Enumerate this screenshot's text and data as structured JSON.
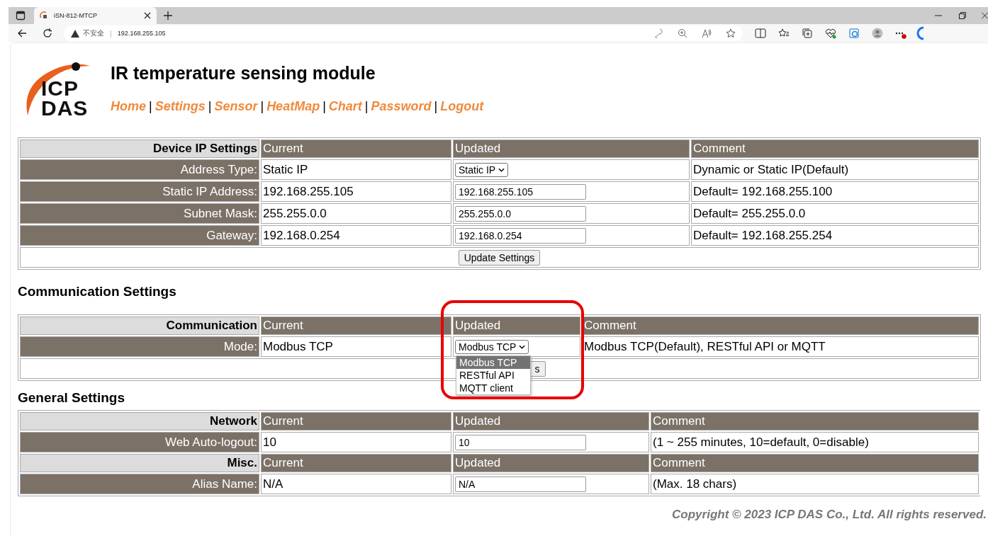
{
  "browser": {
    "tab_title": "iSN-812-MTCP",
    "security_label": "不安全",
    "divider": "|",
    "url": "192.168.255.105"
  },
  "header": {
    "logo_lines": [
      "ICP",
      "DAS"
    ],
    "title": "IR temperature sensing module",
    "separator": "|",
    "nav": [
      {
        "label": "Home"
      },
      {
        "label": "Settings"
      },
      {
        "label": "Sensor"
      },
      {
        "label": "HeatMap"
      },
      {
        "label": "Chart"
      },
      {
        "label": "Password"
      },
      {
        "label": "Logout"
      }
    ]
  },
  "sections": [
    {
      "head": [
        "Device IP Settings",
        "Current",
        "Updated",
        "Comment"
      ],
      "rows": [
        {
          "label": "Address Type:",
          "current": "Static IP",
          "updated": {
            "kind": "select",
            "value": "Static IP"
          },
          "comment": "Dynamic or Static IP(Default)"
        },
        {
          "label": "Static IP Address:",
          "current": "192.168.255.105",
          "updated": {
            "kind": "input",
            "value": "192.168.255.105"
          },
          "comment": "Default= 192.168.255.100"
        },
        {
          "label": "Subnet Mask:",
          "current": "255.255.0.0",
          "updated": {
            "kind": "input",
            "value": "255.255.0.0"
          },
          "comment": "Default= 255.255.0.0"
        },
        {
          "label": "Gateway:",
          "current": "192.168.0.254",
          "updated": {
            "kind": "input",
            "value": "192.168.0.254"
          },
          "comment": "Default= 192.168.255.254"
        }
      ],
      "button": {
        "label": "Update Settings",
        "covered": false
      }
    },
    {
      "title": "Communication Settings",
      "head": [
        "Communication",
        "Current",
        "Updated",
        "Comment"
      ],
      "rows": [
        {
          "label": "Mode:",
          "current": "Modbus TCP",
          "updated": {
            "kind": "select",
            "value": "Modbus TCP",
            "open": true,
            "options": [
              {
                "label": "Modbus TCP",
                "selected": true
              },
              {
                "label": "RESTful API",
                "selected": false
              },
              {
                "label": "MQTT client",
                "selected": false
              }
            ]
          },
          "comment": "Modbus TCP(Default), RESTful API or MQTT"
        }
      ],
      "button": {
        "label": "s",
        "covered": true
      }
    },
    {
      "title": "General Settings",
      "groups": [
        {
          "head": [
            "Network",
            "Current",
            "Updated",
            "Comment"
          ],
          "rows": [
            {
              "label": "Web Auto-logout:",
              "current": "10",
              "updated": {
                "kind": "input",
                "value": "10"
              },
              "comment": "(1 ~ 255 minutes, 10=default, 0=disable)"
            }
          ]
        },
        {
          "head": [
            "Misc.",
            "Current",
            "Updated",
            "Comment"
          ],
          "rows": [
            {
              "label": "Alias Name:",
              "current": "N/A",
              "updated": {
                "kind": "input",
                "value": "N/A"
              },
              "comment": "(Max. 18 chars)"
            }
          ]
        }
      ]
    }
  ],
  "footer": "Copyright © 2023 ICP DAS Co., Ltd. All rights reserved."
}
